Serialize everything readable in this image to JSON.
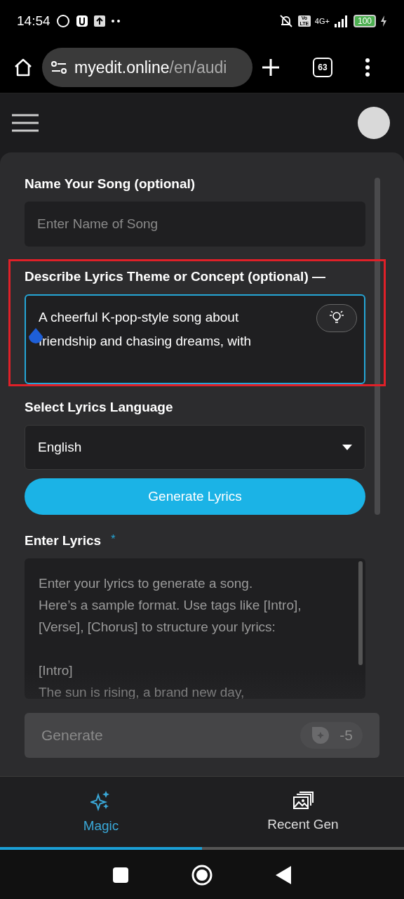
{
  "status_bar": {
    "time": "14:54",
    "network": "4G+",
    "volte": "Vo LTE",
    "battery": "100",
    "charging": true
  },
  "browser": {
    "url_host": "myedit.online",
    "url_path": "/en/audi",
    "tab_count": "63"
  },
  "form": {
    "song_name": {
      "label": "Name Your Song (optional)",
      "placeholder": "Enter Name of Song"
    },
    "theme": {
      "label": "Describe Lyrics Theme or Concept (optional) —",
      "value": "A cheerful K-pop-style song about friendship and chasing dreams, with",
      "focused": true,
      "highlighted": true
    },
    "language": {
      "label": "Select Lyrics Language",
      "value": "English"
    },
    "generate_lyrics": "Generate Lyrics",
    "lyrics": {
      "label": "Enter Lyrics",
      "required_mark": "*",
      "placeholder": "Enter your lyrics to generate a song.\nHere’s a sample format. Use tags like [Intro],\n[Verse], [Chorus] to structure your lyrics:\n\n[Intro]\nThe sun is rising, a brand new day,"
    },
    "generate": {
      "label": "Generate",
      "cost": "-5",
      "disabled": true
    }
  },
  "bottom_tabs": [
    {
      "label": "Magic",
      "kind": "magic",
      "selected": true
    },
    {
      "label": "Recent Gen",
      "kind": "gallery",
      "selected": false
    }
  ]
}
